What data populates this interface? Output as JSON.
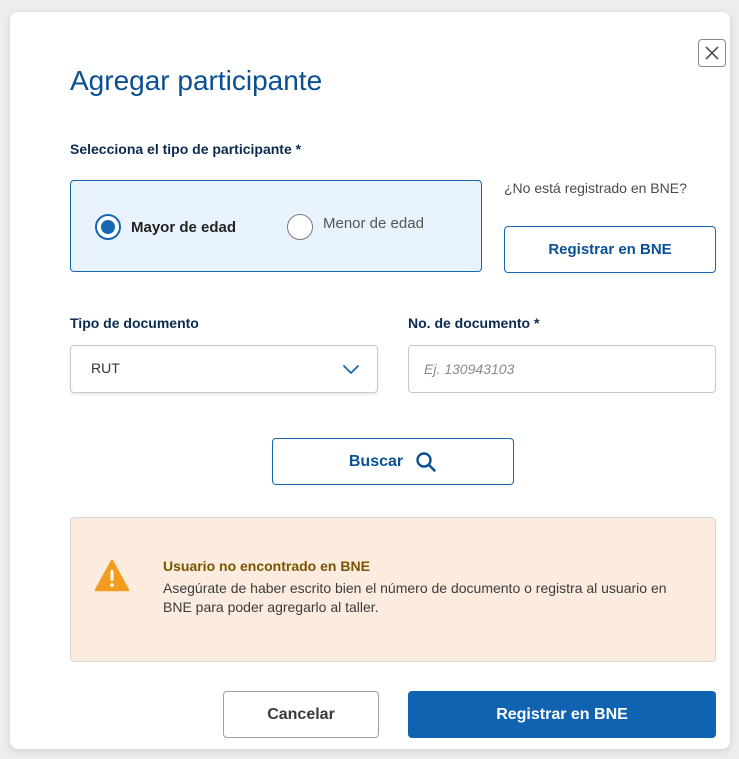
{
  "modal": {
    "title": "Agregar participante"
  },
  "participant_type": {
    "label": "Selecciona el tipo de participante *",
    "options": [
      {
        "label": "Mayor de edad",
        "selected": true
      },
      {
        "label": "Menor de edad",
        "selected": false
      }
    ]
  },
  "registration": {
    "helper_text": "¿No está registrado en BNE?",
    "button_label": "Registrar en BNE"
  },
  "document_type": {
    "label": "Tipo de documento",
    "value": "RUT"
  },
  "document_number": {
    "label": "No. de documento *",
    "value": "",
    "placeholder": "Ej. 130943103"
  },
  "search": {
    "button_label": "Buscar"
  },
  "alert": {
    "title": "Usuario no encontrado en BNE",
    "message": "Asegúrate de haber escrito bien el número de documento o registra al usuario en BNE para poder agregarlo al taller."
  },
  "footer": {
    "cancel_label": "Cancelar",
    "primary_label": "Registrar en BNE"
  },
  "colors": {
    "accent": "#1766b3",
    "title": "#0a4f93",
    "primary_button": "#0f63b0",
    "radio_panel_bg": "#e8f3fd",
    "alert_bg": "#fcebdf",
    "alert_icon": "#f39c1f",
    "alert_title": "#7a5400"
  },
  "icons": {
    "close": "close-icon",
    "chevron": "chevron-down-icon",
    "search": "search-icon",
    "warning": "warning-icon"
  }
}
